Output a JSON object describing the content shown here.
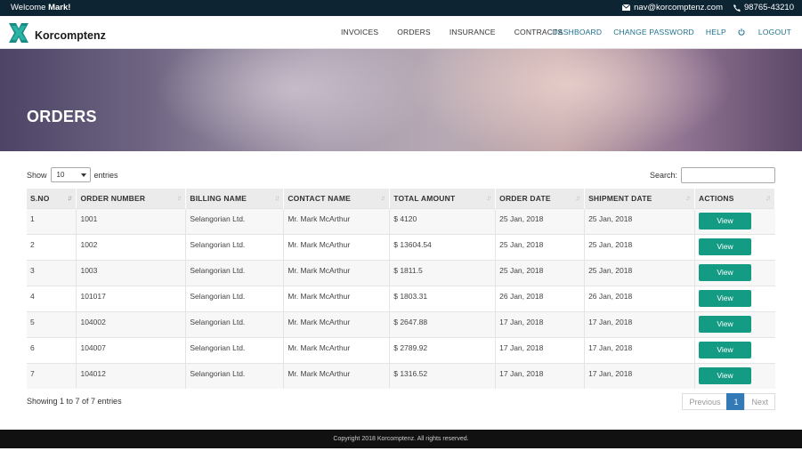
{
  "topbar": {
    "welcome_prefix": "Welcome ",
    "user_name": "Mark!",
    "email": "nav@korcomptenz.com",
    "phone": "98765-43210"
  },
  "brand": {
    "name": "Korcomptenz",
    "logo_color": "#1a8a84"
  },
  "nav": {
    "main": [
      "INVOICES",
      "ORDERS",
      "INSURANCE",
      "CONTRACTS"
    ],
    "account": [
      "DASHBOARD",
      "CHANGE PASSWORD",
      "HELP"
    ],
    "logout": "LOGOUT"
  },
  "hero": {
    "title": "ORDERS"
  },
  "table_controls": {
    "show_label": "Show",
    "entries_value": "10",
    "entries_label": "entries",
    "search_label": "Search:",
    "search_value": ""
  },
  "table": {
    "columns": [
      "S.NO",
      "ORDER NUMBER",
      "BILLING NAME",
      "CONTACT NAME",
      "TOTAL AMOUNT",
      "ORDER DATE",
      "SHIPMENT DATE",
      "ACTIONS"
    ],
    "action_label": "View",
    "rows": [
      [
        "1",
        "1001",
        "Selangorian Ltd.",
        "Mr. Mark McArthur",
        "$ 4120",
        "25 Jan, 2018",
        "25 Jan, 2018"
      ],
      [
        "2",
        "1002",
        "Selangorian Ltd.",
        "Mr. Mark McArthur",
        "$ 13604.54",
        "25 Jan, 2018",
        "25 Jan, 2018"
      ],
      [
        "3",
        "1003",
        "Selangorian Ltd.",
        "Mr. Mark McArthur",
        "$ 1811.5",
        "25 Jan, 2018",
        "25 Jan, 2018"
      ],
      [
        "4",
        "101017",
        "Selangorian Ltd.",
        "Mr. Mark McArthur",
        "$ 1803.31",
        "26 Jan, 2018",
        "26 Jan, 2018"
      ],
      [
        "5",
        "104002",
        "Selangorian Ltd.",
        "Mr. Mark McArthur",
        "$ 2647.88",
        "17 Jan, 2018",
        "17 Jan, 2018"
      ],
      [
        "6",
        "104007",
        "Selangorian Ltd.",
        "Mr. Mark McArthur",
        "$ 2789.92",
        "17 Jan, 2018",
        "17 Jan, 2018"
      ],
      [
        "7",
        "104012",
        "Selangorian Ltd.",
        "Mr. Mark McArthur",
        "$ 1316.52",
        "17 Jan, 2018",
        "17 Jan, 2018"
      ]
    ]
  },
  "table_info": "Showing 1 to 7 of 7 entries",
  "pagination": {
    "previous": "Previous",
    "current": "1",
    "next": "Next"
  },
  "footer": {
    "copyright": "Copyright 2018 Korcomptenz. All rights reserved."
  },
  "colors": {
    "topbar_bg": "#0d2433",
    "accent_button": "#149b84",
    "nav_link": "#1e6f8c",
    "page_active": "#337ab7"
  }
}
